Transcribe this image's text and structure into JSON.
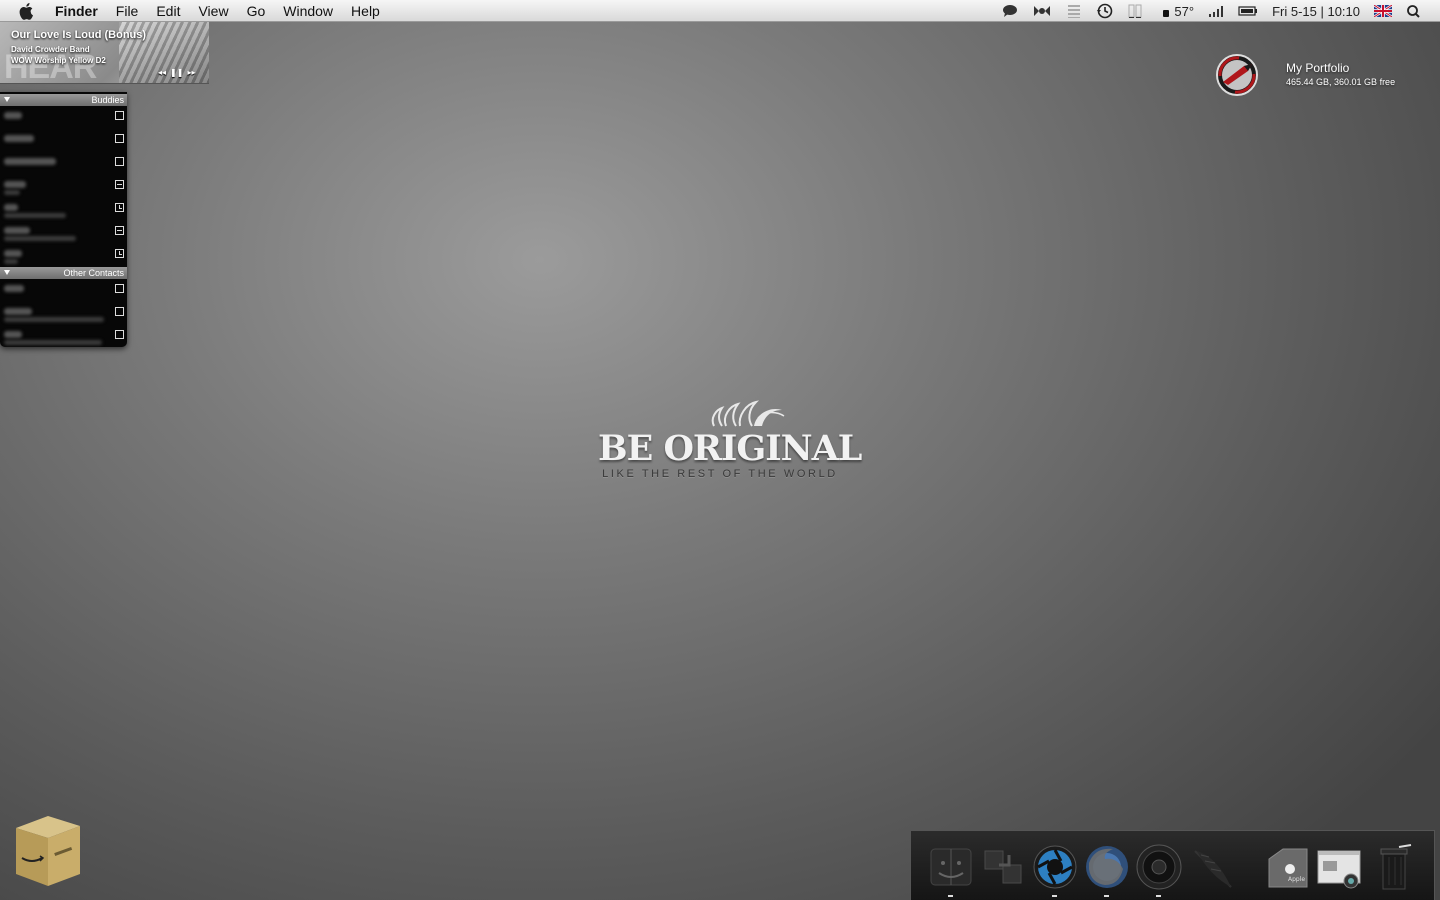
{
  "menubar": {
    "app_name": "Finder",
    "menus": [
      "File",
      "Edit",
      "View",
      "Go",
      "Window",
      "Help"
    ],
    "status": {
      "temperature": "57°",
      "datetime": "Fri 5-15 | 10:10"
    }
  },
  "now_playing": {
    "title": "Our Love Is Loud (Bonus)",
    "artist": "David Crowder Band",
    "album": "WOW Worship Yellow D2",
    "art_text": "HEAR",
    "prev_label": "◂◂",
    "pause_label": "❚❚",
    "next_label": "▸▸"
  },
  "buddy_list": {
    "groups": [
      {
        "label": "Buddies",
        "status_icons": [
          "available",
          "available",
          "available",
          "away",
          "idle",
          "away",
          "idle"
        ]
      },
      {
        "label": "Other Contacts",
        "status_icons": [
          "available",
          "available",
          "available"
        ]
      }
    ]
  },
  "drive": {
    "name": "My Portfolio",
    "space": "465.44 GB, 360.01 GB free",
    "icon": "planet-express-drive-icon"
  },
  "wallpaper": {
    "title": "BE ORIGINAL",
    "subtitle": "LIKE THE REST OF THE WORLD"
  },
  "desktop": {
    "icon": "amazon-box-icon"
  },
  "dock": {
    "items": [
      "finder-icon",
      "spaces-icon",
      "aperture-icon",
      "firefox-icon",
      "speaker-icon",
      "feather-icon",
      "apple-folder-icon",
      "preview-window-icon",
      "trash-icon"
    ],
    "running": [
      "finder-icon",
      "aperture-icon",
      "firefox-icon",
      "speaker-icon"
    ]
  },
  "colors": {
    "menubar_bg": "#e6e6e6",
    "desktop_bg": "#6f6f6f",
    "buddy_bg": "#070707",
    "dock_bg": "#1f1f1f"
  }
}
